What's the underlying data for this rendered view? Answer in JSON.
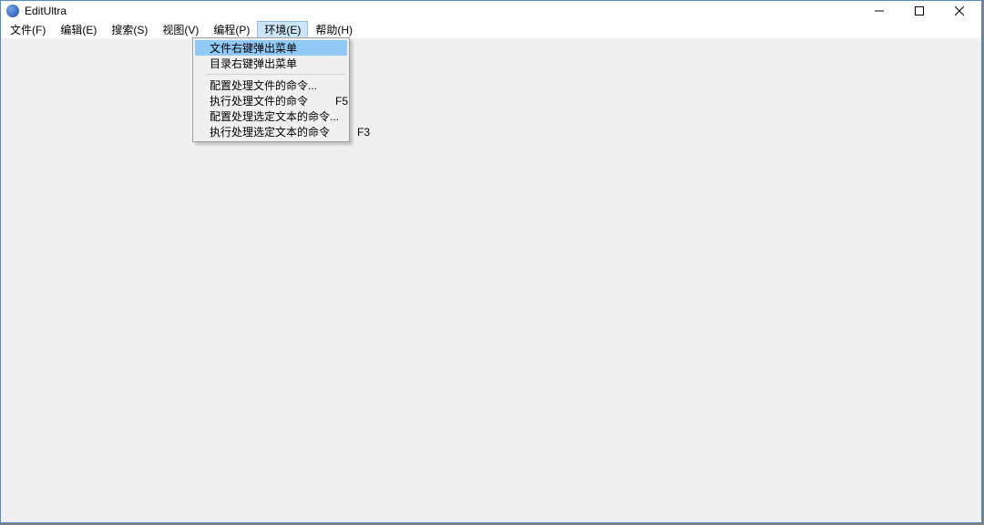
{
  "window": {
    "title": "EditUltra"
  },
  "menubar": {
    "items": [
      {
        "id": "file",
        "label": "文件(F)"
      },
      {
        "id": "edit",
        "label": "编辑(E)"
      },
      {
        "id": "search",
        "label": "搜索(S)"
      },
      {
        "id": "view",
        "label": "视图(V)"
      },
      {
        "id": "coding",
        "label": "编程(P)"
      },
      {
        "id": "env",
        "label": "环境(E)"
      },
      {
        "id": "help",
        "label": "帮助(H)"
      }
    ],
    "open_index": 5
  },
  "dropdown": {
    "groups": [
      [
        {
          "id": "file-rclick-menu",
          "label": "文件右键弹出菜单",
          "accel": "",
          "highlight": true
        },
        {
          "id": "dir-rclick-menu",
          "label": "目录右键弹出菜单",
          "accel": "",
          "highlight": false
        }
      ],
      [
        {
          "id": "cfg-file-cmd",
          "label": "配置处理文件的命令...",
          "accel": "",
          "highlight": false
        },
        {
          "id": "run-file-cmd",
          "label": "执行处理文件的命令",
          "accel": "F5",
          "highlight": false
        },
        {
          "id": "cfg-seltxt-cmd",
          "label": "配置处理选定文本的命令...",
          "accel": "",
          "highlight": false
        },
        {
          "id": "run-seltxt-cmd",
          "label": "执行处理选定文本的命令",
          "accel": "F3",
          "highlight": false
        }
      ]
    ]
  }
}
